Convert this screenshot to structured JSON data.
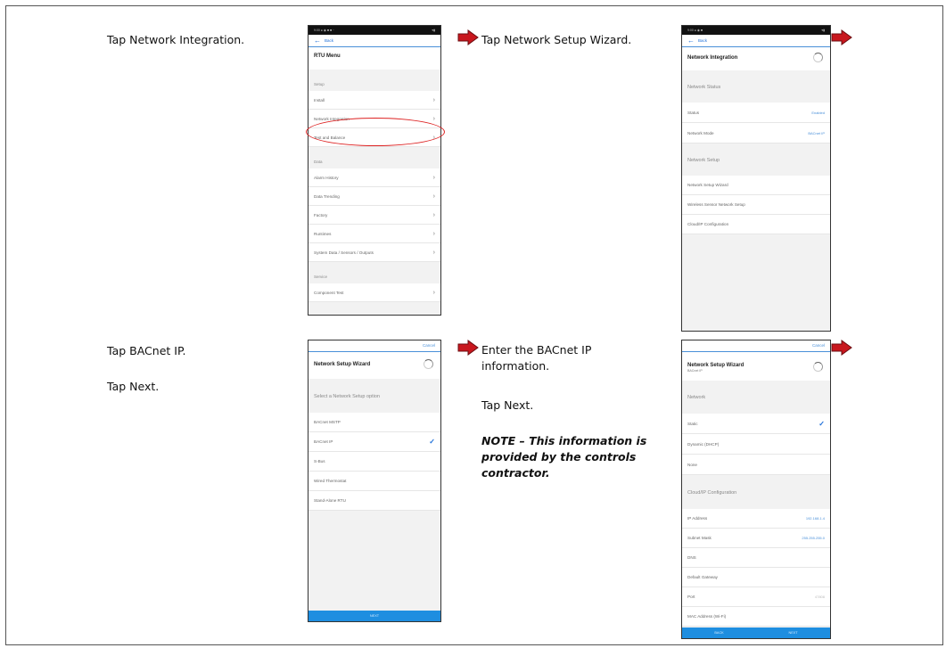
{
  "steps": {
    "s1": {
      "instruction": "Tap Network Integration."
    },
    "s2": {
      "instruction": "Tap Network Setup Wizard."
    },
    "s3": {
      "line1": "Tap BACnet IP.",
      "line2": "Tap Next."
    },
    "s4": {
      "line1": "Enter the BACnet IP information.",
      "line2": "Tap Next.",
      "note": "NOTE – This information is provided by the controls contractor."
    }
  },
  "colors": {
    "arrow": "#c8171e",
    "accent": "#1e6fd9",
    "highlight_ring": "#dd2222",
    "footer": "#1e8ee0"
  },
  "phone1": {
    "status_time": "9:00 ● ◉ ■ ■ ··",
    "status_right": "▾▮",
    "back": "Back",
    "title": "RTU Menu",
    "sections": [
      {
        "header": "Setup",
        "items": [
          "Install",
          "Network Integration",
          "Test and Balance"
        ]
      },
      {
        "header": "Data",
        "items": [
          "Alarm History",
          "Data Trending",
          "Factory",
          "Runtimes",
          "System Data / Sensors / Outputs"
        ]
      },
      {
        "header": "Service",
        "items": [
          "Component Test"
        ]
      }
    ]
  },
  "phone2": {
    "status_time": "9:00 ● ◉ ■",
    "status_right": "▾▮",
    "back": "Back",
    "title": "Network Integration",
    "status_section": "Network Status",
    "status_rows": [
      {
        "label": "Status",
        "value": "Enabled"
      },
      {
        "label": "Network Mode",
        "value": "BACnet IP"
      }
    ],
    "setup_section": "Network Setup",
    "setup_items": [
      "Network Setup Wizard",
      "Wireless Sensor Network Setup",
      "Cloud/IP Configuration"
    ]
  },
  "phone3": {
    "cancel": "Cancel",
    "title": "Network Setup Wizard",
    "prompt": "Select a Network Setup option",
    "options": [
      "BACnet MSTP",
      "BACnet IP",
      "S-Bus",
      "Wired Thermostat",
      "Stand-Alone RTU"
    ],
    "selected": "BACnet IP",
    "footer_next": "NEXT"
  },
  "phone4": {
    "cancel": "Cancel",
    "title": "Network Setup Wizard",
    "subtitle": "BACnet IP",
    "network_section": "Network",
    "network_options": [
      "Static",
      "Dynamic (DHCP)",
      "None"
    ],
    "selected": "Static",
    "config_section": "Cloud/IP Configuration",
    "fields": [
      {
        "label": "IP Address",
        "value": "192.168.1.4"
      },
      {
        "label": "Subnet Mask",
        "value": "255.255.255.0"
      },
      {
        "label": "DNS",
        "value": ""
      },
      {
        "label": "Default Gateway",
        "value": ""
      },
      {
        "label": "Port",
        "value": "47808"
      },
      {
        "label": "MAC Address (Wi-Fi)",
        "value": ""
      }
    ],
    "footer_back": "BACK",
    "footer_next": "NEXT"
  }
}
